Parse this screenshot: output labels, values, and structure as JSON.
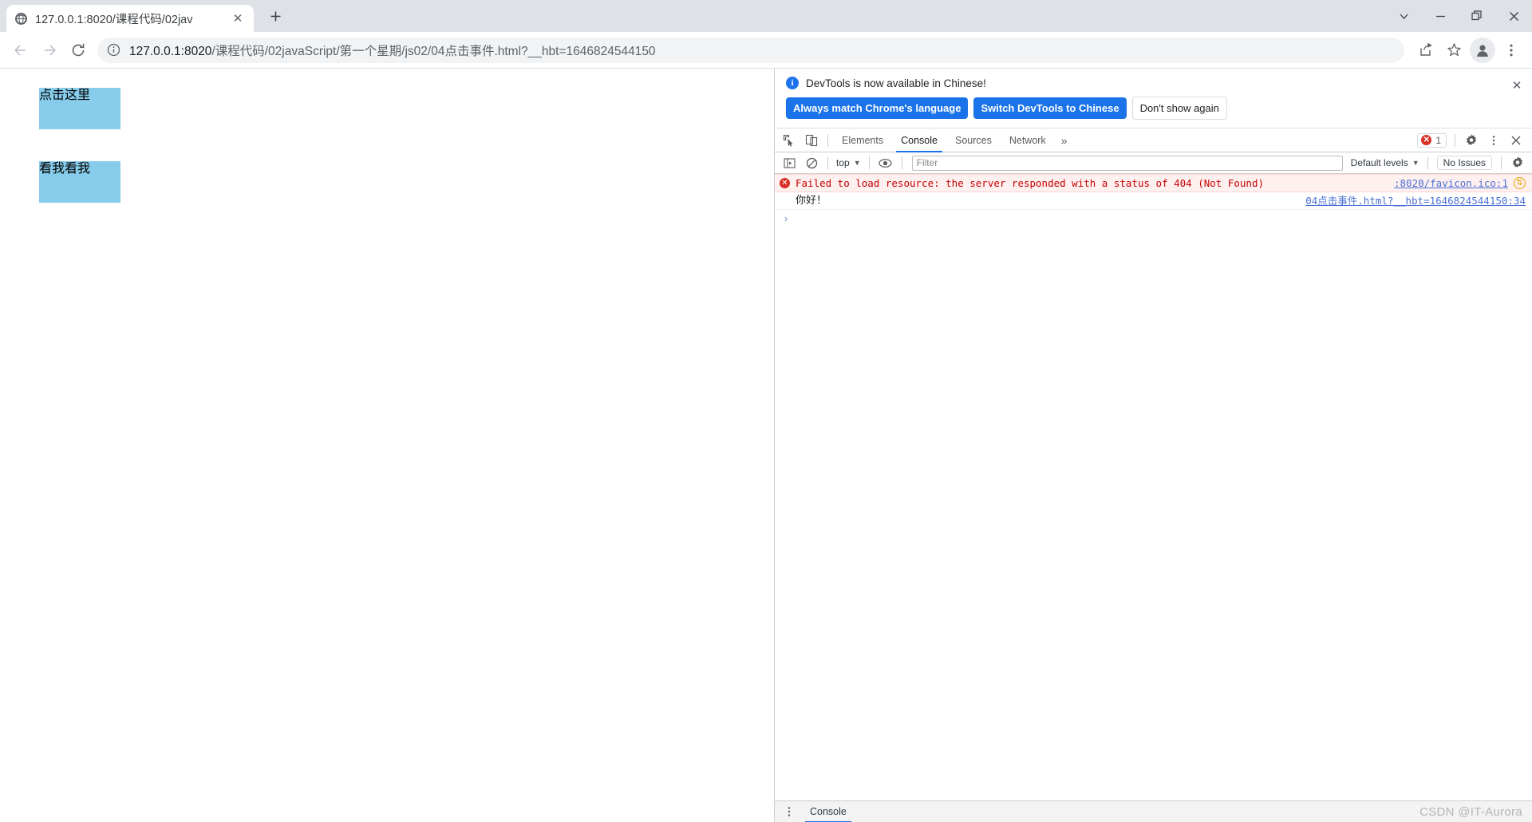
{
  "window": {
    "controls": [
      {
        "name": "tab-search",
        "glyph": "chevron-down"
      },
      {
        "name": "minimize",
        "glyph": "minus"
      },
      {
        "name": "maximize",
        "glyph": "square"
      },
      {
        "name": "close",
        "glyph": "x"
      }
    ]
  },
  "tab": {
    "title": "127.0.0.1:8020/课程代码/02jav",
    "favicon": "globe-icon",
    "close_label": "✕",
    "newtab_label": "+"
  },
  "toolbar": {
    "back_label": "←",
    "forward_label": "→",
    "reload_label": "⟳",
    "url_host": "127.0.0.1:8020",
    "url_rest": "/课程代码/02javaScript/第一个星期/js02/04点击事件.html?__hbt=1646824544150",
    "url_full": "127.0.0.1:8020/课程代码/02javaScript/第一个星期/js02/04点击事件.html?__hbt=1646824544150",
    "icons": [
      "share-icon",
      "bookmark-star-icon",
      "profile-avatar-icon",
      "chrome-menu-icon"
    ]
  },
  "page": {
    "boxes": [
      {
        "label": "点击这里",
        "color": "#87cdeb"
      },
      {
        "label": "看我看我",
        "color": "#87cdeb"
      }
    ]
  },
  "devtools": {
    "locale_notice": {
      "message": "DevTools is now available in Chinese!",
      "buttons": [
        {
          "label": "Always match Chrome's language",
          "style": "primary"
        },
        {
          "label": "Switch DevTools to Chinese",
          "style": "primary"
        },
        {
          "label": "Don't show again",
          "style": "secondary"
        }
      ],
      "close_label": "✕"
    },
    "tabs": [
      {
        "label": "Elements",
        "active": false
      },
      {
        "label": "Console",
        "active": true
      },
      {
        "label": "Sources",
        "active": false
      },
      {
        "label": "Network",
        "active": false
      }
    ],
    "more_tabs_label": "»",
    "error_count": "1",
    "icons": [
      "inspect-element-icon",
      "device-toolbar-icon",
      "settings-gear-icon",
      "devtools-menu-icon",
      "devtools-close-icon"
    ],
    "console_toolbar": {
      "sidebar_toggle": "console-sidebar-icon",
      "clear_label": "clear-console-icon",
      "context": "top",
      "eye_label": "live-expression-icon",
      "filter_placeholder": "Filter",
      "filter_value": "",
      "levels": "Default levels",
      "issues": "No Issues",
      "settings": "console-settings-icon"
    },
    "messages": [
      {
        "type": "error",
        "text": "Failed to load resource: the server responded with a status of 404 (Not Found)",
        "source": ":8020/favicon.ico:1",
        "badge": "⇅"
      },
      {
        "type": "log",
        "text": "你好！",
        "source": "04点击事件.html?__hbt=1646824544150:34",
        "badge": ""
      }
    ],
    "prompt": "›",
    "drawer": {
      "menu_label": "drawer-menu-icon",
      "tab": "Console"
    }
  },
  "watermark": "CSDN @IT-Aurora",
  "colors": {
    "accent": "#1a73e8",
    "error": "#d93025",
    "box_blue": "#87cdeb",
    "tabstrip": "#dee1e6"
  }
}
